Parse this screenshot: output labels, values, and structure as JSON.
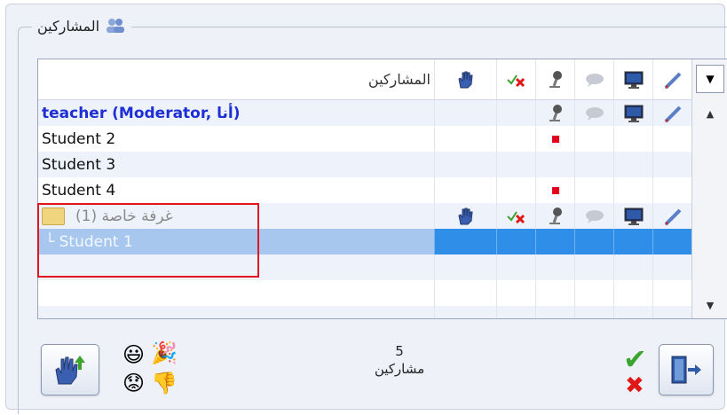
{
  "panel": {
    "title": "المشاركين"
  },
  "grid": {
    "header": {
      "name_label": "المشاركين"
    },
    "rows": [
      {
        "label": "teacher (Moderator, أنا)",
        "kind": "moderator"
      },
      {
        "label": "Student 2",
        "kind": "student"
      },
      {
        "label": "Student 3",
        "kind": "student"
      },
      {
        "label": "Student 4",
        "kind": "student"
      },
      {
        "label": "غرفة خاصة (1)",
        "kind": "room"
      },
      {
        "label": "└ Student 1",
        "kind": "selected"
      }
    ],
    "scroll_up": "▲",
    "scroll_down": "▼",
    "dropdown": "▼"
  },
  "footer": {
    "participant_count": "5",
    "participant_label": "مشاركين"
  },
  "icons": {
    "hand": "hand-icon",
    "check_x": "approve-deny-icon",
    "mic": "microphone-icon",
    "chat": "chat-icon",
    "screen": "monitor-icon",
    "pen": "pen-icon",
    "exit": "exit-door-icon"
  },
  "colors": {
    "moderator": "#1f2fd6",
    "selection": "#2f8fe8",
    "highlight": "#e0151f",
    "accent_green": "#3ba52f"
  }
}
